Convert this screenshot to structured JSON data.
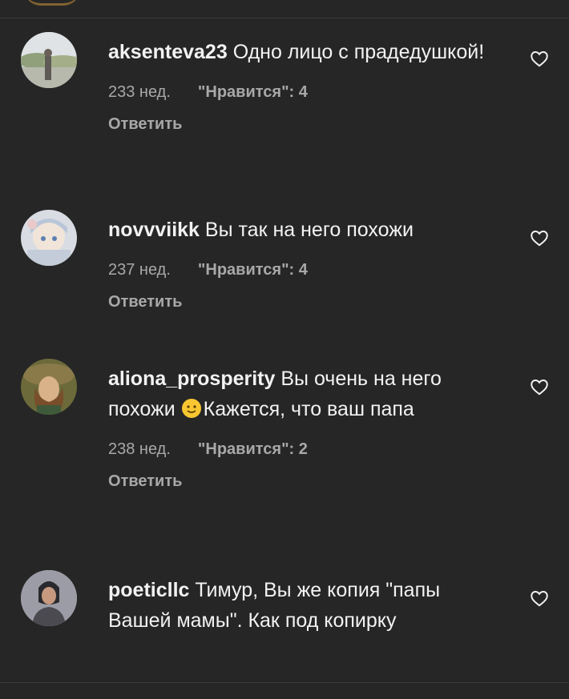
{
  "comments": [
    {
      "username": "aksenteva23",
      "text": "Одно лицо с прадедушкой!",
      "time": "233 нед.",
      "likes": "\"Нравится\": 4",
      "reply": "Ответить",
      "avatar_icon": "landscape-avatar"
    },
    {
      "username": "novvviikk",
      "text": "Вы так на него похожи",
      "time": "237 нед.",
      "likes": "\"Нравится\": 4",
      "reply": "Ответить",
      "avatar_icon": "anime-avatar"
    },
    {
      "username": "aliona_prosperity",
      "text_before_emoji": "Вы очень на него похожи ",
      "emoji_icon": "slightly-smiling-face-emoji",
      "text_after_emoji": "Кажется, что ваш папа",
      "time": "238 нед.",
      "likes": "\"Нравится\": 2",
      "reply": "Ответить",
      "avatar_icon": "portrait-painting-avatar"
    },
    {
      "username": "poeticllc",
      "text": "Тимур, Вы же копия \"папы Вашей мамы\". Как под копирку",
      "avatar_icon": "person-avatar"
    }
  ],
  "icons": {
    "like": "heart-outline-icon"
  },
  "colors": {
    "background": "#262626",
    "primary_text": "#f2f2f2",
    "secondary_text": "#a8a8a8",
    "divider": "#3a3a3a"
  }
}
